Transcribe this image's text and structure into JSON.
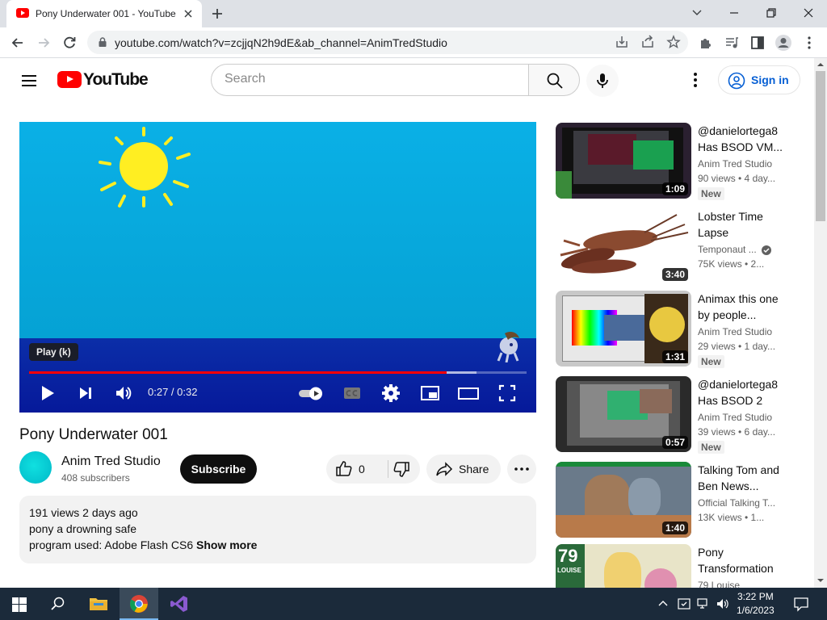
{
  "browser": {
    "tab_title": "Pony Underwater 001 - YouTube",
    "url": "youtube.com/watch?v=zcjjqN2h9dE&ab_channel=AnimTredStudio"
  },
  "youtube": {
    "logo_text": "YouTube",
    "search_placeholder": "Search",
    "signin_label": "Sign in"
  },
  "player": {
    "tooltip": "Play (k)",
    "time": "0:27 / 0:32",
    "progress_fraction": 0.84,
    "buffered_fraction": 0.9
  },
  "video": {
    "title": "Pony Underwater 001",
    "channel": "Anim Tred Studio",
    "subscribers": "408 subscribers",
    "subscribe_label": "Subscribe",
    "likes": "0",
    "share_label": "Share",
    "description": {
      "stats": "191 views  2 days ago",
      "line1": "pony a drowning safe",
      "line2": "program used: Adobe Flash CS6",
      "show_more": "Show more"
    }
  },
  "recommendations": [
    {
      "title": "@danielortega8 Has BSOD VM...",
      "channel": "Anim Tred Studio",
      "meta": "90 views  • 4 day...",
      "duration": "1:09",
      "badge": "New"
    },
    {
      "title": "Lobster Time Lapse",
      "channel": "Temponaut ...",
      "meta": "75K views  • 2...",
      "duration": "3:40",
      "badge": ""
    },
    {
      "title": "Animax this one by people...",
      "channel": "Anim Tred Studio",
      "meta": "29 views  • 1 day...",
      "duration": "1:31",
      "badge": "New"
    },
    {
      "title": "@danielortega8 Has BSOD 2",
      "channel": "Anim Tred Studio",
      "meta": "39 views  • 6 day...",
      "duration": "0:57",
      "badge": "New"
    },
    {
      "title": "Talking Tom and Ben News...",
      "channel": "Official Talking T...",
      "meta": "13K views  • 1...",
      "duration": "1:40",
      "badge": ""
    },
    {
      "title": "Pony Transformation",
      "channel": "79 Louise",
      "meta": "",
      "duration": "",
      "badge": "",
      "thumb_text_1": "79",
      "thumb_text_2": "LOUISE"
    }
  ],
  "taskbar": {
    "time": "3:22 PM",
    "date": "1/6/2023"
  },
  "colors": {
    "youtube_red": "#ff0000",
    "progress_red": "#ff0000",
    "link_blue": "#065fd4"
  }
}
